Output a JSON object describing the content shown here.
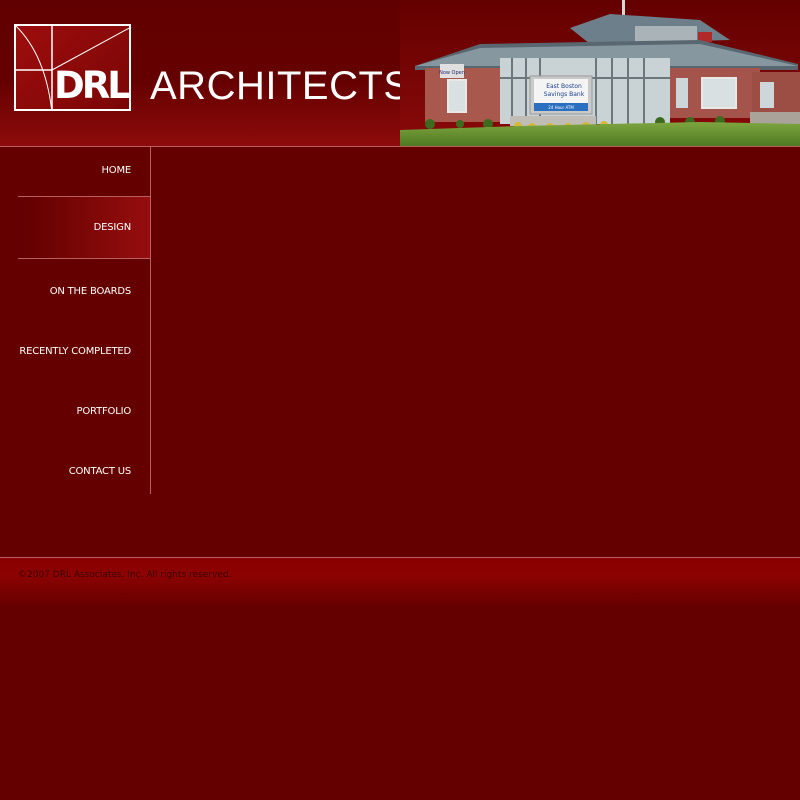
{
  "brand": {
    "logo_text": "DRL",
    "name": "ARCHITECTS"
  },
  "hero_photo": {
    "sign_line1": "East Boston",
    "sign_line2": "Savings Bank",
    "sign_line3": "24 Hour ATM",
    "banner_text": "Now Open"
  },
  "nav": {
    "items": [
      {
        "label": "HOME"
      },
      {
        "label": "DESIGN"
      },
      {
        "label": "ON THE BOARDS"
      },
      {
        "label": "RECENTLY COMPLETED"
      },
      {
        "label": "PORTFOLIO"
      },
      {
        "label": "CONTACT US"
      }
    ],
    "active": "DESIGN"
  },
  "footer": {
    "copyright": "©2007 DRL Associates, Inc. All rights reserved."
  },
  "colors": {
    "background": "#640000",
    "accent": "#960e0e",
    "text": "#ffffff",
    "rule": "#b86060"
  }
}
